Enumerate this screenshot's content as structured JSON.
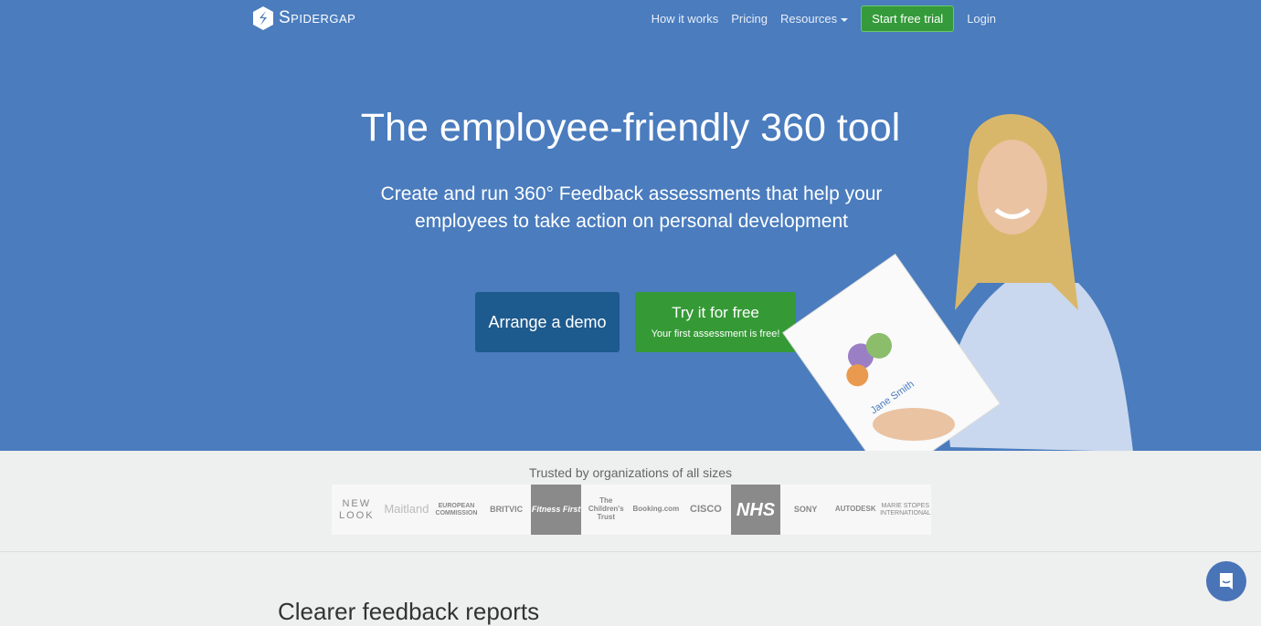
{
  "nav": {
    "brand": "Spidergap",
    "links": [
      "How it works",
      "Pricing",
      "Resources"
    ],
    "cta": "Start free trial",
    "login": "Login"
  },
  "hero": {
    "title": "The employee-friendly 360 tool",
    "subtitle": "Create and run 360° Feedback assessments that help your employees to take action on personal development",
    "demo_button": "Arrange a demo",
    "free_button": "Try it for free",
    "free_button_sub": "Your first assessment is free!",
    "report_name": "Jane Smith"
  },
  "trust": {
    "heading": "Trusted by organizations of all sizes",
    "logos": [
      "NEW LOOK",
      "Maitland",
      "EUROPEAN COMMISSION",
      "BRITVIC",
      "Fitness First",
      "The Children's Trust",
      "Booking.com",
      "CISCO",
      "NHS",
      "SONY",
      "AUTODESK",
      "MARIE STOPES INTERNATIONAL"
    ]
  },
  "section": {
    "title": "Clearer feedback reports"
  },
  "colors": {
    "hero_bg": "#4a7cbe",
    "primary_cta": "#359a36",
    "demo": "#1d5a8e"
  }
}
